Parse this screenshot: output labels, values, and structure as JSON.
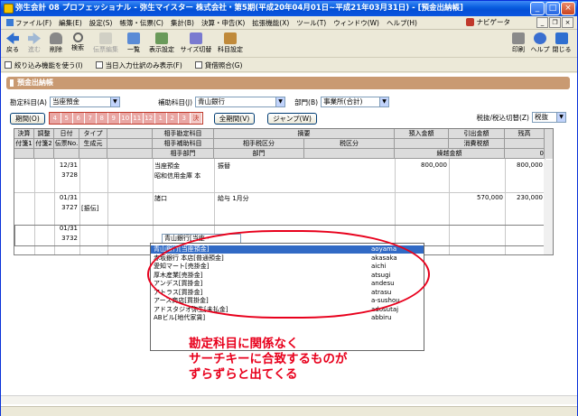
{
  "window": {
    "title": "弥生会計 08 プロフェッショナル - 弥生マイスター 株式会社・第5期(平成20年04月01日~平成21年03月31日) - [預金出納帳]"
  },
  "menu": [
    "ファイル(F)",
    "編集(E)",
    "設定(S)",
    "帳簿・伝票(C)",
    "集計(B)",
    "決算・申告(K)",
    "拡張機能(X)",
    "ツール(T)",
    "ウィンドウ(W)",
    "ヘルプ(H)"
  ],
  "navi_label": "ナビゲータ",
  "toolbar": {
    "left": [
      "戻る",
      "進む",
      "削除",
      "検索",
      "伝票編集",
      "一覧",
      "表示設定",
      "サイズ切替",
      "科目設定"
    ],
    "right": [
      "印刷",
      "ヘルプ",
      "閉じる"
    ]
  },
  "options": [
    "絞り込み機能を使う(I)",
    "当日入力仕訳のみ表示(F)",
    "貸借照合(G)"
  ],
  "section_title": "預金出納帳",
  "filters": {
    "account_label": "勘定科目(A)",
    "account_value": "当座預金",
    "sub_label": "補助科目(J)",
    "sub_value": "青山銀行",
    "dept_label": "部門(B)",
    "dept_value": "事業所(合計)"
  },
  "period": {
    "label": "期間(O)",
    "months": [
      "4",
      "5",
      "6",
      "7",
      "8",
      "9",
      "10",
      "11",
      "12",
      "1",
      "2",
      "3",
      "決"
    ],
    "all_button": "全期間(V)",
    "jump_button": "ジャンプ(W)",
    "tax_label": "税抜/税込切替(Z)",
    "tax_value": "税抜"
  },
  "grid": {
    "headers_row1": [
      "決算",
      "調整",
      "日付",
      "タイプ",
      "",
      "相手勘定科目",
      "摘要",
      "預入金額",
      "引出金額",
      "残高"
    ],
    "headers_row2": [
      "付箋1",
      "付箋2",
      "伝票No.",
      "生成元",
      "",
      "相手補助科目",
      "相手税区分",
      "税区分",
      "消費税額",
      "消費税額"
    ],
    "headers_row3": [
      "",
      "",
      "",
      "",
      "",
      "相手部門",
      "部門",
      "",
      "繰越金額",
      "0"
    ],
    "rows": [
      {
        "date": "12/31",
        "no": "3728",
        "type": "",
        "account": "当座預金",
        "sub": "昭和信用金庫 本",
        "memo": "振替",
        "deposit": "800,000",
        "withdraw": "",
        "balance": "800,000"
      },
      {
        "date": "01/31",
        "no": "3727",
        "type": "[振伝]",
        "account": "諸口",
        "sub": "",
        "memo": "給与 1月分",
        "deposit": "",
        "withdraw": "570,000",
        "balance": "230,000"
      },
      {
        "date": "01/31",
        "no": "3732",
        "type": "",
        "account": "",
        "sub": "",
        "memo": "",
        "deposit": "",
        "withdraw": "",
        "balance": ""
      }
    ],
    "edit_value": "青山銀行[当座・"
  },
  "dropdown": [
    {
      "name": "青山銀行[当座預金]",
      "kana": "aoyama"
    },
    {
      "name": "赤坂銀行 本店[普通預金]",
      "kana": "akasaka"
    },
    {
      "name": "愛知マート[売掛金]",
      "kana": "aichi"
    },
    {
      "name": "厚木産業[売掛金]",
      "kana": "atsugi"
    },
    {
      "name": "アンデス[買掛金]",
      "kana": "andesu"
    },
    {
      "name": "アトラス[買掛金]",
      "kana": "atrasu"
    },
    {
      "name": "アース商店[買掛金]",
      "kana": "a-sushou"
    },
    {
      "name": "アドスタジオ弥生[未払金]",
      "kana": "adosutaj"
    },
    {
      "name": "ABビル[地代家賃]",
      "kana": "abbiru"
    }
  ],
  "annotation": [
    "勘定科目に関係なく",
    "サーチキーに合致するものが",
    "ずらずらと出てくる"
  ],
  "colors": {
    "annotation": "#e8001c",
    "section": "#c99a72",
    "selected": "#316ac5"
  }
}
